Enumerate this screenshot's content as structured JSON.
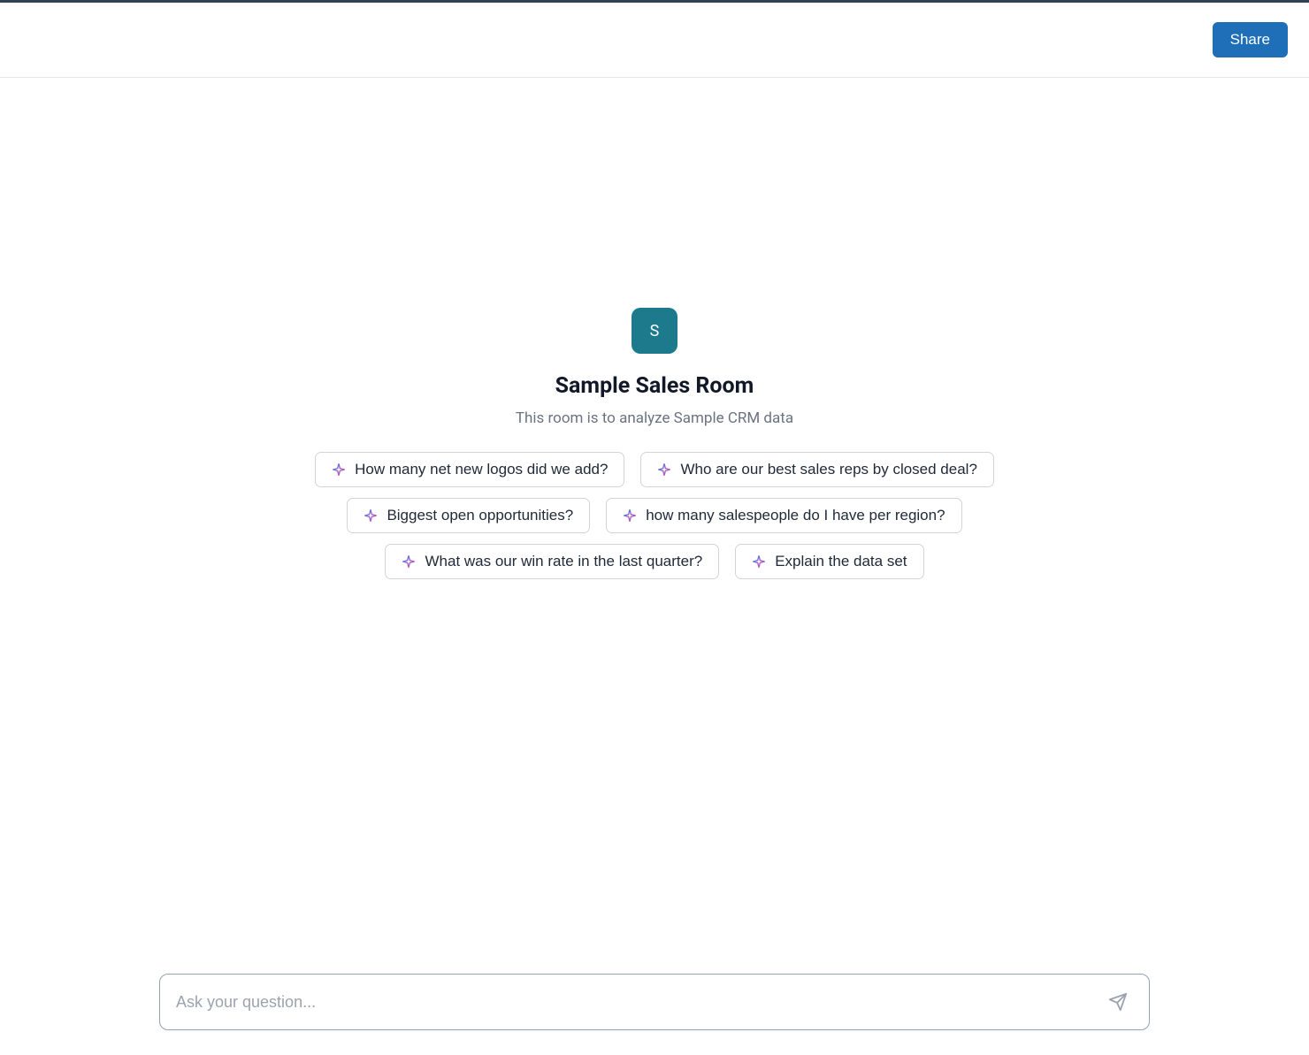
{
  "header": {
    "share_label": "Share"
  },
  "room": {
    "avatar_letter": "S",
    "title": "Sample Sales Room",
    "description": "This room is to analyze Sample CRM data"
  },
  "suggestions": {
    "row1": [
      "How many net new logos did we add?",
      "Who are our best sales reps by closed deal?"
    ],
    "row2": [
      "Biggest open opportunities?",
      "how many salespeople do I have per region?"
    ],
    "row3": [
      "What was our win rate in the last quarter?",
      "Explain the data set"
    ]
  },
  "input": {
    "placeholder": "Ask your question..."
  }
}
